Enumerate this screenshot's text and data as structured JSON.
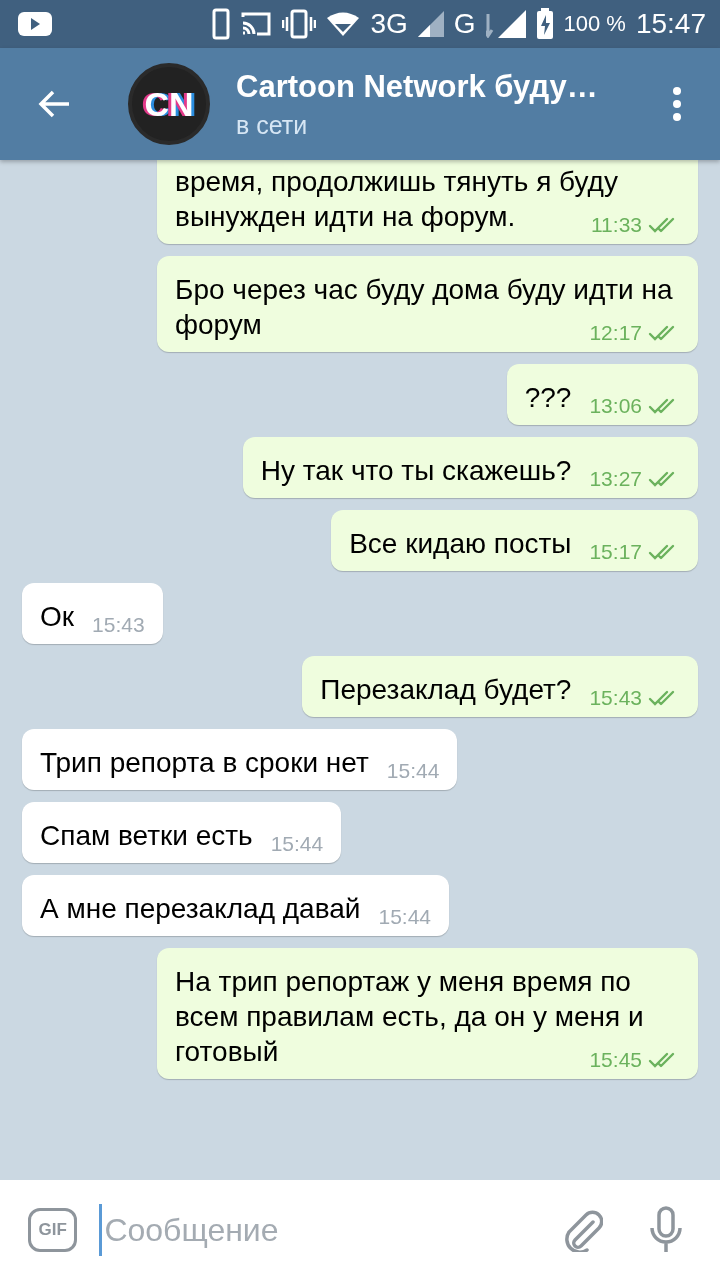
{
  "status_bar": {
    "network_3g": "3G",
    "network_g": "G",
    "battery": "100 %",
    "time": "15:47"
  },
  "header": {
    "avatar_text": "CN",
    "title": "Cartoon Network буду…",
    "status": "в сети"
  },
  "messages": [
    {
      "kind": "out",
      "text": "время, продолжишь тянуть я буду вынужден идти на форум.",
      "time": "11:33",
      "read": true
    },
    {
      "kind": "out",
      "text": "Бро через час буду дома буду идти на форум",
      "time": "12:17",
      "read": true
    },
    {
      "kind": "out",
      "text": "???",
      "time": "13:06",
      "read": true
    },
    {
      "kind": "out",
      "text": "Ну так что ты скажешь?",
      "time": "13:27",
      "read": true
    },
    {
      "kind": "out",
      "text": "Все кидаю посты",
      "time": "15:17",
      "read": true
    },
    {
      "kind": "in",
      "text": "Ок",
      "time": "15:43"
    },
    {
      "kind": "out",
      "text": "Перезаклад будет?",
      "time": "15:43",
      "read": true
    },
    {
      "kind": "in",
      "text": "Трип репорта в сроки нет",
      "time": "15:44"
    },
    {
      "kind": "in",
      "text": "Спам ветки есть",
      "time": "15:44"
    },
    {
      "kind": "in",
      "text": "А мне перезаклад давай",
      "time": "15:44"
    },
    {
      "kind": "out",
      "text": "На трип репортаж у меня время по всем правилам есть, да он у меня и готовый",
      "time": "15:45",
      "read": true
    }
  ],
  "composer": {
    "gif_label": "GIF",
    "placeholder": "Сообщение"
  }
}
